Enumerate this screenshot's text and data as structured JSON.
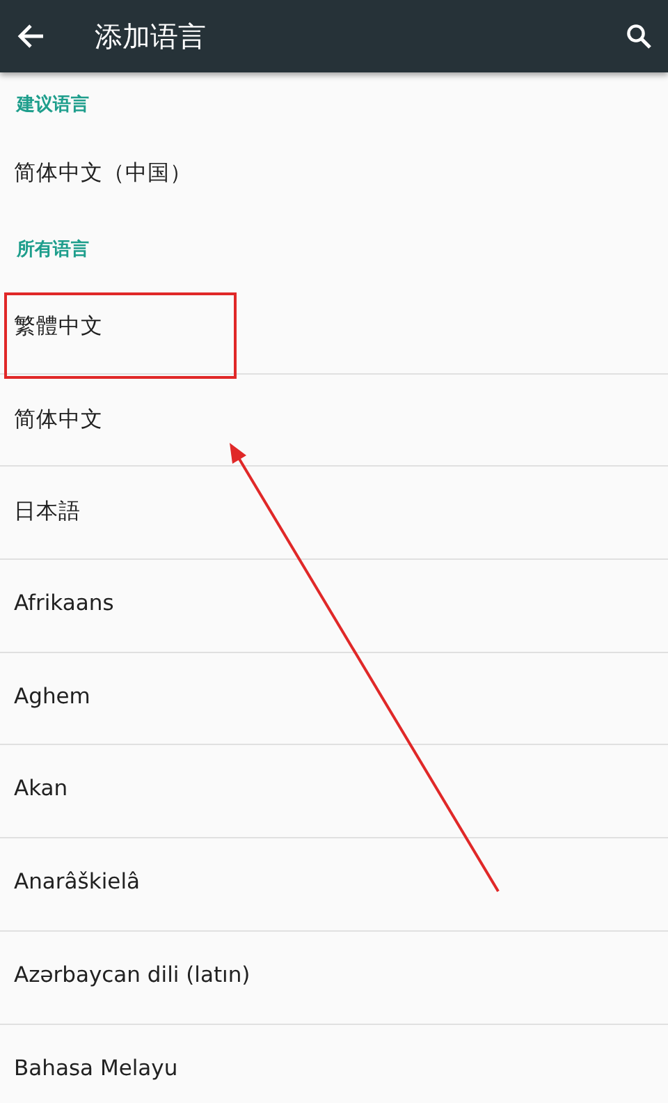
{
  "app_bar": {
    "title": "添加语言"
  },
  "sections": [
    {
      "header": "建议语言",
      "items": [
        {
          "label": "简体中文（中国）"
        }
      ]
    },
    {
      "header": "所有语言",
      "items": [
        {
          "label": "繁體中文"
        },
        {
          "label": "简体中文"
        },
        {
          "label": "日本語"
        },
        {
          "label": "Afrikaans"
        },
        {
          "label": "Aghem"
        },
        {
          "label": "Akan"
        },
        {
          "label": "Anarâškielâ"
        },
        {
          "label": "Azərbaycan dili (latın)"
        },
        {
          "label": "Bahasa Melayu"
        }
      ]
    }
  ]
}
